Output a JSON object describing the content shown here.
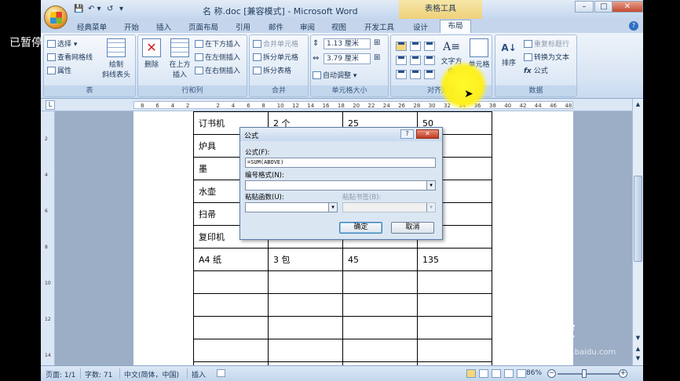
{
  "overlay": {
    "paused_label": "已暂停"
  },
  "titlebar": {
    "doc_title": "名 称.doc [兼容模式] - Microsoft Word",
    "context_title": "表格工具",
    "qat_save": "💾",
    "qat_undo": "↶ ▾",
    "qat_redo": "↺",
    "qat_more": "▾",
    "min": "–",
    "max": "□",
    "close": "✕"
  },
  "tabs": [
    "经典菜单",
    "开始",
    "插入",
    "页面布局",
    "引用",
    "邮件",
    "审阅",
    "视图",
    "开发工具",
    "设计",
    "布局"
  ],
  "ribbon": {
    "table": {
      "label": "表",
      "select": "选择 ▾",
      "gridlines": "查看网格线",
      "properties": "属性",
      "draw_diag": "绘制",
      "draw_diag2": "斜线表头"
    },
    "rows_cols": {
      "label": "行和列",
      "delete": "删除",
      "insert_above": "在上方",
      "insert_above2": "插入",
      "insert_below": "在下方插入",
      "insert_left": "在左侧插入",
      "insert_right": "在右侧插入"
    },
    "merge": {
      "label": "合并",
      "merge_cells": "合并单元格",
      "split_cells": "拆分单元格",
      "split_table": "拆分表格"
    },
    "cell_size": {
      "label": "单元格大小",
      "height": "1.13 厘米",
      "width": "3.79 厘米",
      "autofit": "自动调整 ▾"
    },
    "alignment": {
      "label": "对齐方式",
      "text_direction": "文字方向",
      "cell_margins": "单元格"
    },
    "data": {
      "label": "数据",
      "sort": "排序",
      "repeat_header": "重复标题行",
      "convert": "转换为文本",
      "formula": "公式"
    }
  },
  "ruler": {
    "ticks": [
      "8",
      "6",
      "4",
      "2",
      "",
      "2",
      "4",
      "6",
      "8",
      "10",
      "12",
      "14",
      "16",
      "18",
      "20",
      "22",
      "24",
      "26",
      "28",
      "30",
      "32",
      "34",
      "36",
      "38",
      "40",
      "42",
      "44",
      "46",
      "48"
    ],
    "vticks": [
      "",
      "2",
      "",
      "4",
      "",
      "6",
      "",
      "8",
      "",
      "10",
      "",
      "12",
      "",
      "14"
    ]
  },
  "table_rows": [
    [
      "订书机",
      "2 个",
      "25",
      "50"
    ],
    [
      "炉具",
      "",
      "",
      ""
    ],
    [
      "墨",
      "",
      "",
      ""
    ],
    [
      "水壶",
      "",
      "",
      ""
    ],
    [
      "扫帚",
      "",
      "",
      ""
    ],
    [
      "复印机",
      "",
      "",
      ""
    ],
    [
      "A4 纸",
      "3 包",
      "45",
      "135"
    ],
    [
      "",
      "",
      "",
      ""
    ],
    [
      "",
      "",
      "",
      ""
    ],
    [
      "",
      "",
      "",
      ""
    ],
    [
      "",
      "",
      "",
      ""
    ],
    [
      "",
      "",
      "",
      ""
    ]
  ],
  "dialog": {
    "title": "公式",
    "help": "?",
    "close": "✕",
    "formula_label": "公式(F):",
    "formula_value": "=SUM(ABOVE)",
    "number_format_label": "编号格式(N):",
    "number_format_value": "",
    "paste_function_label": "粘贴函数(U):",
    "paste_function_value": "",
    "paste_bookmark_label": "粘贴书签(B):",
    "paste_bookmark_value": "",
    "ok": "确定",
    "cancel": "取消"
  },
  "statusbar": {
    "page": "页面: 1/1",
    "words": "字数: 71",
    "language": "中文(简体，中国)",
    "mode": "插入",
    "zoom": "86%",
    "zoom_value": 86
  },
  "watermark": {
    "brand": "Bai经验",
    "url": "jingyan.baidu.com"
  }
}
